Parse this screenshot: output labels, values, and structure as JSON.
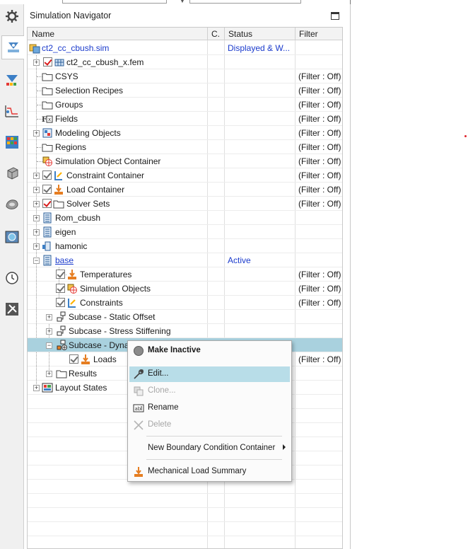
{
  "navigator": {
    "title": "Simulation Navigator",
    "columns": {
      "name": "Name",
      "c": "C.",
      "status": "Status",
      "filter": "Filter"
    }
  },
  "toolbar": {
    "icons": [
      "gear-icon",
      "simulation-navigator-icon",
      "post-processing-navigator-icon",
      "xy-function-navigator-icon",
      "results-icon",
      "part-icon",
      "assembly-icon",
      "web-browser-icon",
      "history-icon",
      "tools-icon"
    ]
  },
  "tree": [
    {
      "label": "ct2_cc_cbush.sim",
      "status": "Displayed & W...",
      "filter": "",
      "blue": true
    },
    {
      "label": "ct2_cc_cbush_x.fem",
      "status": "",
      "filter": ""
    },
    {
      "label": "CSYS",
      "status": "",
      "filter": "(Filter : Off)"
    },
    {
      "label": "Selection Recipes",
      "status": "",
      "filter": "(Filter : Off)"
    },
    {
      "label": "Groups",
      "status": "",
      "filter": "(Filter : Off)"
    },
    {
      "label": "Fields",
      "status": "",
      "filter": "(Filter : Off)"
    },
    {
      "label": "Modeling Objects",
      "status": "",
      "filter": "(Filter : Off)"
    },
    {
      "label": "Regions",
      "status": "",
      "filter": "(Filter : Off)"
    },
    {
      "label": "Simulation Object Container",
      "status": "",
      "filter": "(Filter : Off)"
    },
    {
      "label": "Constraint Container",
      "status": "",
      "filter": "(Filter : Off)"
    },
    {
      "label": "Load Container",
      "status": "",
      "filter": "(Filter : Off)"
    },
    {
      "label": "Solver Sets",
      "status": "",
      "filter": "(Filter : Off)"
    },
    {
      "label": "Rom_cbush",
      "status": "",
      "filter": ""
    },
    {
      "label": "eigen",
      "status": "",
      "filter": ""
    },
    {
      "label": "hamonic",
      "status": "",
      "filter": ""
    },
    {
      "label": "base",
      "status": "Active",
      "filter": "",
      "blue": true
    },
    {
      "label": "Temperatures",
      "status": "",
      "filter": "(Filter : Off)"
    },
    {
      "label": "Simulation Objects",
      "status": "",
      "filter": "(Filter : Off)"
    },
    {
      "label": "Constraints",
      "status": "",
      "filter": "(Filter : Off)"
    },
    {
      "label": "Subcase - Static Offset",
      "status": "",
      "filter": ""
    },
    {
      "label": "Subcase - Stress Stiffening",
      "status": "",
      "filter": ""
    },
    {
      "label": "Subcase - Dyna",
      "status": "",
      "filter": ""
    },
    {
      "label": "Loads",
      "status": "",
      "filter": "(Filter : Off)"
    },
    {
      "label": "Results",
      "status": "",
      "filter": ""
    },
    {
      "label": "Layout States",
      "status": "",
      "filter": ""
    }
  ],
  "context_menu": {
    "make_inactive": "Make Inactive",
    "edit": "Edit...",
    "clone": "Clone...",
    "rename": "Rename",
    "delete": "Delete",
    "new_bc_container": "New Boundary Condition Container",
    "mechanical_load_summary": "Mechanical Load Summary"
  },
  "colors": {
    "selection": "#a9d1de",
    "menu_highlight": "#b8dde8",
    "link_blue": "#1b3bcc",
    "check_red": "#d81b1b"
  }
}
